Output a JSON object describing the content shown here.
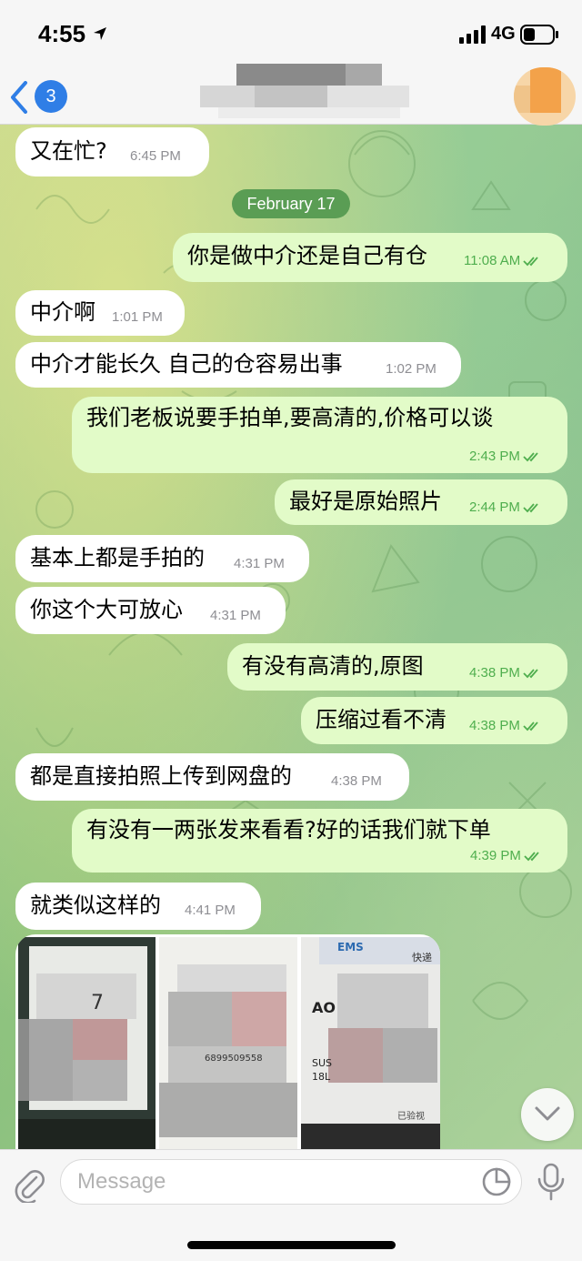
{
  "status_bar": {
    "time": "4:55",
    "network": "4G"
  },
  "header": {
    "back_count": "3"
  },
  "date_separator": "February 17",
  "messages": [
    {
      "dir": "in",
      "text": "又在忙?",
      "time": "6:45 PM"
    },
    {
      "dir": "out",
      "text": "你是做中介还是自己有仓",
      "time": "11:08 AM",
      "read": true
    },
    {
      "dir": "in",
      "text": "中介啊",
      "time": "1:01 PM"
    },
    {
      "dir": "in",
      "text": "中介才能长久 自己的仓容易出事",
      "time": "1:02 PM"
    },
    {
      "dir": "out",
      "text": "我们老板说要手拍单,要高清的,价格可以谈",
      "time": "2:43 PM",
      "read": true
    },
    {
      "dir": "out",
      "text": "最好是原始照片",
      "time": "2:44 PM",
      "read": true
    },
    {
      "dir": "in",
      "text": "基本上都是手拍的",
      "time": "4:31 PM"
    },
    {
      "dir": "in",
      "text": "你这个大可放心",
      "time": "4:31 PM"
    },
    {
      "dir": "out",
      "text": "有没有高清的,原图",
      "time": "4:38 PM",
      "read": true
    },
    {
      "dir": "out",
      "text": "压缩过看不清",
      "time": "4:38 PM",
      "read": true
    },
    {
      "dir": "in",
      "text": "都是直接拍照上传到网盘的",
      "time": "4:38 PM"
    },
    {
      "dir": "out",
      "text": "有没有一两张发来看看?好的话我们就下单",
      "time": "4:39 PM",
      "read": true
    },
    {
      "dir": "in",
      "text": "就类似这样的",
      "time": "4:41 PM"
    }
  ],
  "photo_album": {
    "photo_count": 3,
    "visible_label_text": [
      "EMS",
      "快递",
      "AO",
      "SUS",
      "18L",
      "已验视",
      "6899509558",
      "7"
    ]
  },
  "input": {
    "placeholder": "Message"
  },
  "colors": {
    "incoming_bubble": "#ffffff",
    "outgoing_bubble": "#e2fbc8",
    "outgoing_meta": "#4fae4e",
    "badge": "#2f7ee6",
    "date_pill": "#5a9d54"
  }
}
